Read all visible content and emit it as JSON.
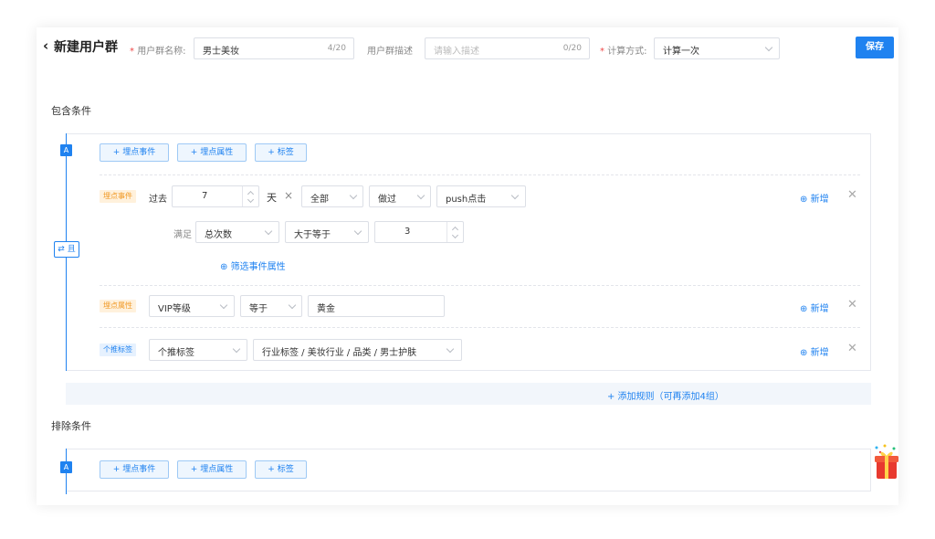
{
  "header": {
    "back_icon": "chevron-left-icon",
    "title": "新建用户群",
    "group_name_label": "用户群名称:",
    "group_name_value": "男士美妆",
    "group_name_count": "4/20",
    "desc_label": "用户群描述",
    "desc_placeholder": "请输入描述",
    "desc_count": "0/20",
    "calc_label": "计算方式:",
    "calc_value": "计算一次",
    "save_label": "保存"
  },
  "include": {
    "title": "包含条件",
    "group_badge": "A",
    "and_label": "且",
    "add_buttons": [
      "+ 埋点事件",
      "+ 埋点属性",
      "+ 标签"
    ],
    "event_rule": {
      "tag": "埋点事件",
      "past_label": "过去",
      "days_value": "7",
      "days_unit": "天",
      "times_symbol": "×",
      "scope": "全部",
      "action": "做过",
      "event": "push点击",
      "satisfy_label": "满足",
      "metric": "总次数",
      "operator": "大于等于",
      "threshold": "3",
      "filter_link": "筛选事件属性"
    },
    "attr_rule": {
      "tag": "埋点属性",
      "attribute": "VIP等级",
      "operator": "等于",
      "value": "黄金"
    },
    "label_rule": {
      "tag": "个推标签",
      "label_type": "个推标签",
      "label_path": "行业标签 / 美妆行业 / 品类 / 男士护肤"
    },
    "add_link": "新增",
    "add_rule": "+ 添加规则（可再添加4组）"
  },
  "exclude": {
    "title": "排除条件",
    "group_badge": "A",
    "add_buttons": [
      "+ 埋点事件",
      "+ 埋点属性",
      "+ 标签"
    ]
  },
  "colors": {
    "accent": "#1f82f0",
    "event_tag": "#f09a28",
    "required": "#f04848"
  }
}
